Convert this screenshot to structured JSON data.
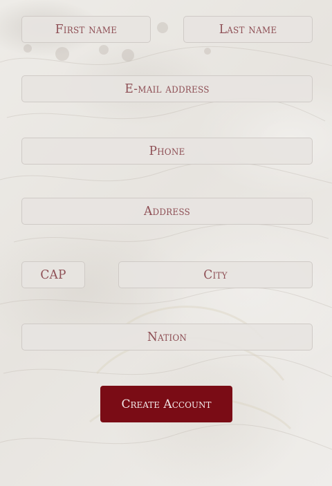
{
  "form": {
    "first_name_placeholder": "First name",
    "last_name_placeholder": "Last name",
    "email_placeholder": "E-mail address",
    "phone_placeholder": "Phone",
    "address_placeholder": "Address",
    "cap_placeholder": "CAP",
    "city_placeholder": "City",
    "nation_placeholder": "Nation",
    "submit_label": "Create Account"
  },
  "colors": {
    "placeholder_text": "#8e4f55",
    "button_bg": "#7a0c15",
    "button_text": "#f3eaea",
    "field_bg": "#e7e4e1",
    "page_bg": "#ebe9e5"
  }
}
